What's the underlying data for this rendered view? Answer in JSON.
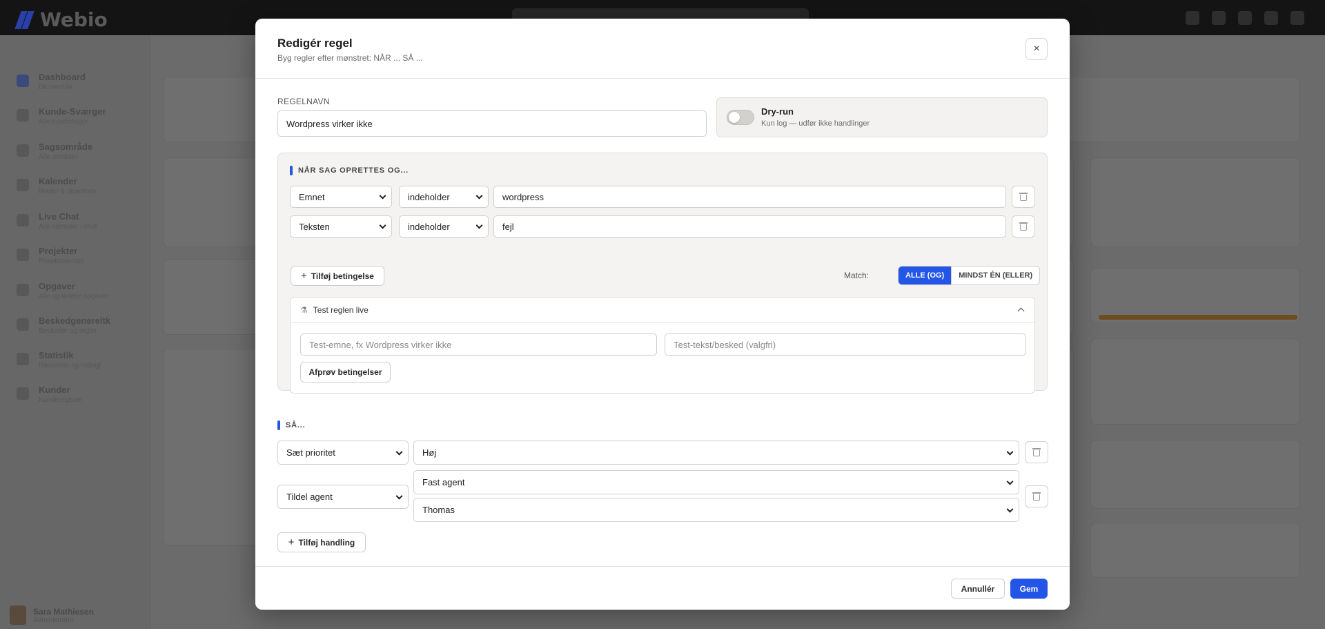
{
  "background": {
    "brand": "Webio",
    "nav": [
      {
        "title": "Dashboard",
        "sub": "Dit overblik"
      },
      {
        "title": "Kunde-Sværger",
        "sub": "Alle kundesager"
      },
      {
        "title": "Sagsområde",
        "sub": "Alle områder"
      },
      {
        "title": "Kalender",
        "sub": "Møder & deadlines"
      },
      {
        "title": "Live Chat",
        "sub": "Alle samtaler i chat"
      },
      {
        "title": "Projekter",
        "sub": "Projektoversigt"
      },
      {
        "title": "Opgaver",
        "sub": "Alle og tildelte opgaver"
      },
      {
        "title": "Beskedgenereltk",
        "sub": "Beskeder og regler"
      },
      {
        "title": "Statistik",
        "sub": "Rapporter og indsigt"
      },
      {
        "title": "Kunder",
        "sub": "Kunderegister"
      }
    ],
    "user": {
      "name": "Sara Mathiesen",
      "role": "Administrator"
    }
  },
  "modal": {
    "title": "Redigér regel",
    "subtitle": "Byg regler efter mønstret: NÅR ... SÅ ...",
    "close_icon": "×",
    "name_label": "Regelnavn",
    "name_value": "Wordpress virker ikke",
    "dryrun": {
      "title": "Dry-run",
      "subtitle": "Kun log — udfør ikke handlinger",
      "enabled": false
    },
    "conditions": {
      "heading": "Når sag oprettes og...",
      "rows": [
        {
          "field": "Emnet",
          "operator": "indeholder",
          "value": "wordpress"
        },
        {
          "field": "Teksten",
          "operator": "indeholder",
          "value": "fejl"
        }
      ],
      "add_label": "Tilføj betingelse",
      "match_label": "Match:",
      "match_all": "ALLE (OG)",
      "match_any": "MINDST ÉN (ELLER)",
      "match_selected": "all"
    },
    "test": {
      "title": "Test reglen live",
      "subject_placeholder": "Test-emne, fx Wordpress virker ikke",
      "text_placeholder": "Test-tekst/besked (valgfri)",
      "run_label": "Afprøv betingelser"
    },
    "actions": {
      "heading": "Så...",
      "rows": [
        {
          "action": "Sæt prioritet",
          "values": [
            "Høj"
          ]
        },
        {
          "action": "Tildel agent",
          "values": [
            "Fast agent",
            "Thomas"
          ]
        }
      ],
      "add_label": "Tilføj handling"
    },
    "footer": {
      "cancel": "Annullér",
      "save": "Gem"
    }
  },
  "colors": {
    "accent": "#2356e6",
    "overlay": "#6b6b6b"
  }
}
